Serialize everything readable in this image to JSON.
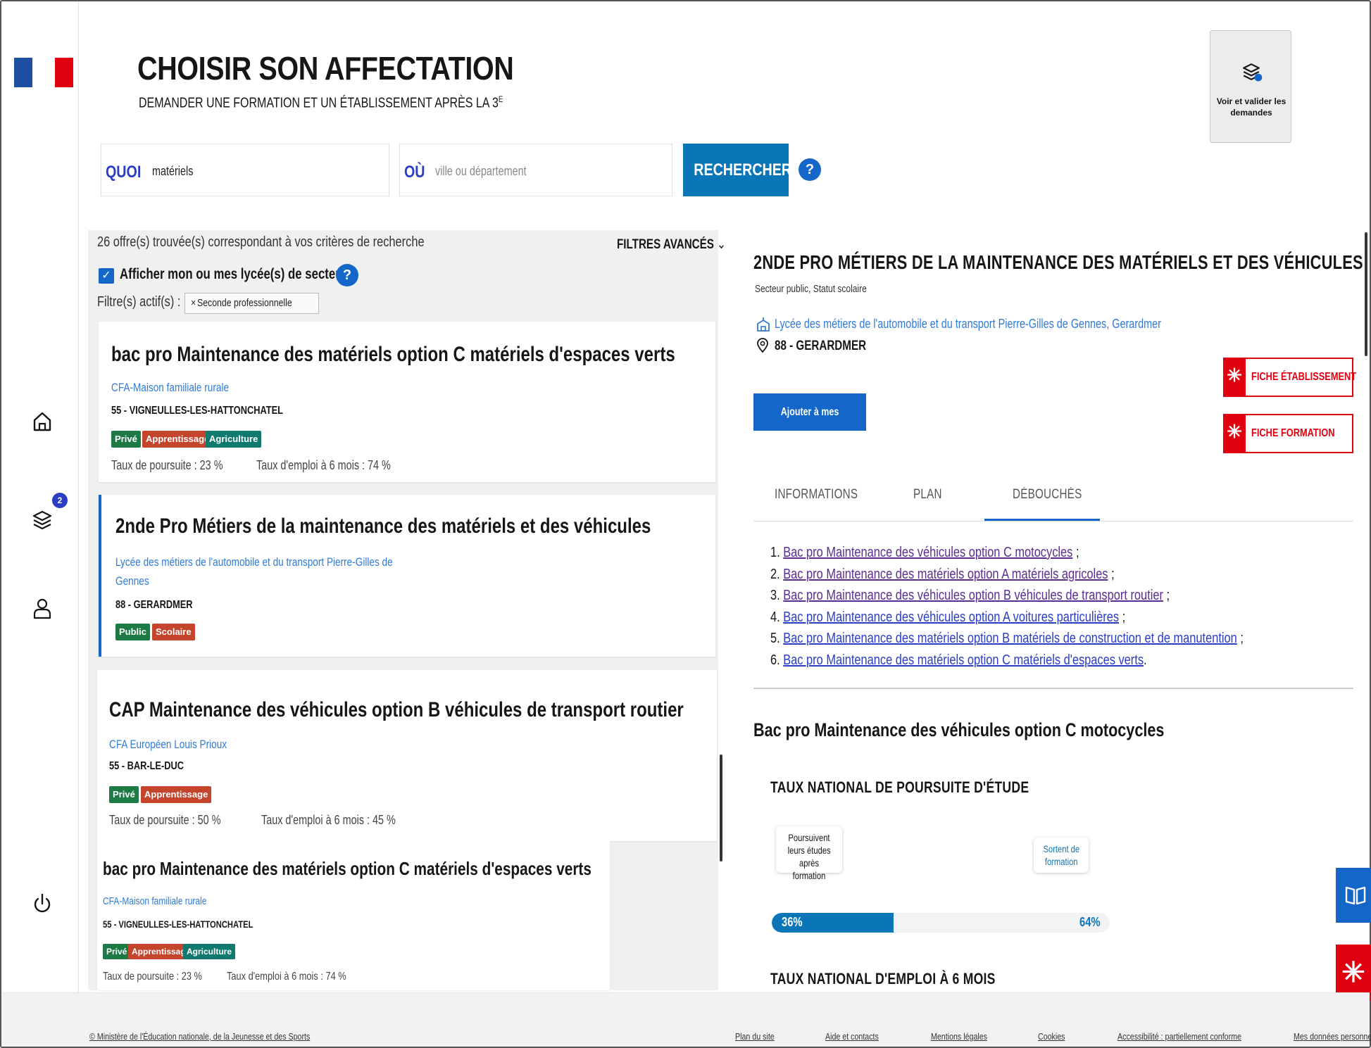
{
  "header": {
    "title": "CHOISIR SON AFFECTATION",
    "subtitle": "DEMANDER UNE FORMATION ET UN ÉTABLISSEMENT APRÈS LA 3",
    "subtitle_sup": "E",
    "valider_label": "Voir et valider les demandes"
  },
  "nav": {
    "requests_badge": "2"
  },
  "search": {
    "quoi_label": "QUOI",
    "quoi_value": "matériels",
    "ou_label": "OÙ",
    "ou_placeholder": "ville ou département",
    "button": "RECHERCHER",
    "help": "?"
  },
  "results": {
    "count_text": "26 offre(s) trouvée(s) correspondant à vos critères de recherche",
    "advanced_filters": "FILTRES AVANCÉS",
    "sector_checkbox": "Afficher mon ou mes lycée(s) de secteur",
    "active_filters_label": "Filtre(s) actif(s) :",
    "active_filter": "Seconde professionnelle",
    "items": [
      {
        "title": "bac pro Maintenance des matériels option C matériels d'espaces verts",
        "school": "CFA-Maison familiale rurale",
        "place": "55 - VIGNEULLES-LES-HATTONCHATEL",
        "tags": [
          "Privé",
          "Apprentissage",
          "Agriculture"
        ],
        "poursuite": "Taux de poursuite : 23 %",
        "emploi": "Taux d'emploi à 6 mois : 74 %"
      },
      {
        "title": "2nde Pro Métiers de la maintenance des matériels et des véhicules",
        "school_line1": "Lycée des métiers de l'automobile et du transport Pierre-Gilles de",
        "school_line2": "Gennes",
        "place": "88 - GERARDMER",
        "tags": [
          "Public",
          "Scolaire"
        ]
      },
      {
        "title": "CAP Maintenance des véhicules option B véhicules de transport routier",
        "school": "CFA Européen Louis Prioux",
        "place": "55 - BAR-LE-DUC",
        "tags": [
          "Privé",
          "Apprentissage"
        ],
        "poursuite": "Taux de poursuite : 50 %",
        "emploi": "Taux d'emploi à 6 mois : 45 %"
      },
      {
        "title": "bac pro Maintenance des matériels option C matériels d'espaces verts",
        "school": "CFA-Maison familiale rurale",
        "place": "55 - VIGNEULLES-LES-HATTONCHATEL",
        "tags": [
          "Privé",
          "Apprentissage",
          "Agriculture"
        ],
        "poursuite": "Taux de poursuite : 23 %",
        "emploi": "Taux d'emploi à 6 mois : 74 %"
      }
    ]
  },
  "detail": {
    "title": "2NDE PRO MÉTIERS DE LA MAINTENANCE DES MATÉRIELS ET DES VÉHICULES",
    "subtitle": "Secteur public, Statut scolaire",
    "lycee": "Lycée des métiers de l'automobile et du transport Pierre-Gilles de Gennes, Gerardmer",
    "place": "88 - GERARDMER",
    "fiche_etab": "FICHE ÉTABLISSEMENT",
    "fiche_form": "FICHE FORMATION",
    "add_button": "Ajouter à mes demandes",
    "tabs": [
      "INFORMATIONS",
      "PLAN",
      "DÉBOUCHÉS"
    ],
    "debouches": [
      "Bac pro Maintenance des véhicules option C motocycles",
      "Bac pro Maintenance des matériels option A matériels agricoles",
      "Bac pro Maintenance des véhicules option B véhicules de transport routier",
      "Bac pro Maintenance des véhicules option A voitures particulières",
      "Bac pro Maintenance des matériels option B matériels de construction et de manutention",
      "Bac pro Maintenance des matériels option C matériels d'espaces verts"
    ],
    "selected_title": "Bac pro Maintenance des véhicules option C motocycles",
    "poursuite_section": "TAUX NATIONAL DE POURSUITE D'ÉTUDE",
    "bubble_left": [
      "Poursuivent",
      "leurs études",
      "après formation"
    ],
    "bubble_right": [
      "Sortent de",
      "formation"
    ],
    "poursuite_pct": 36,
    "poursuite_label": "36%",
    "sortie_label": "64%",
    "emploi_section": "TAUX NATIONAL D'EMPLOI À 6 MOIS"
  },
  "footer": {
    "copyright": "© Ministère de l'Éducation nationale, de la Jeunesse et des Sports",
    "links": [
      "Plan du site",
      "Aide et contacts",
      "Mentions légales",
      "Cookies",
      "Accessibilité : partiellement conforme",
      "Mes données personnelles"
    ]
  },
  "colors": {
    "primary": "#1466c9",
    "accent_blue": "#0a76b8",
    "marianne_red": "#e1000f",
    "tag_green": "#1d7a44",
    "tag_orange": "#c5442c"
  }
}
